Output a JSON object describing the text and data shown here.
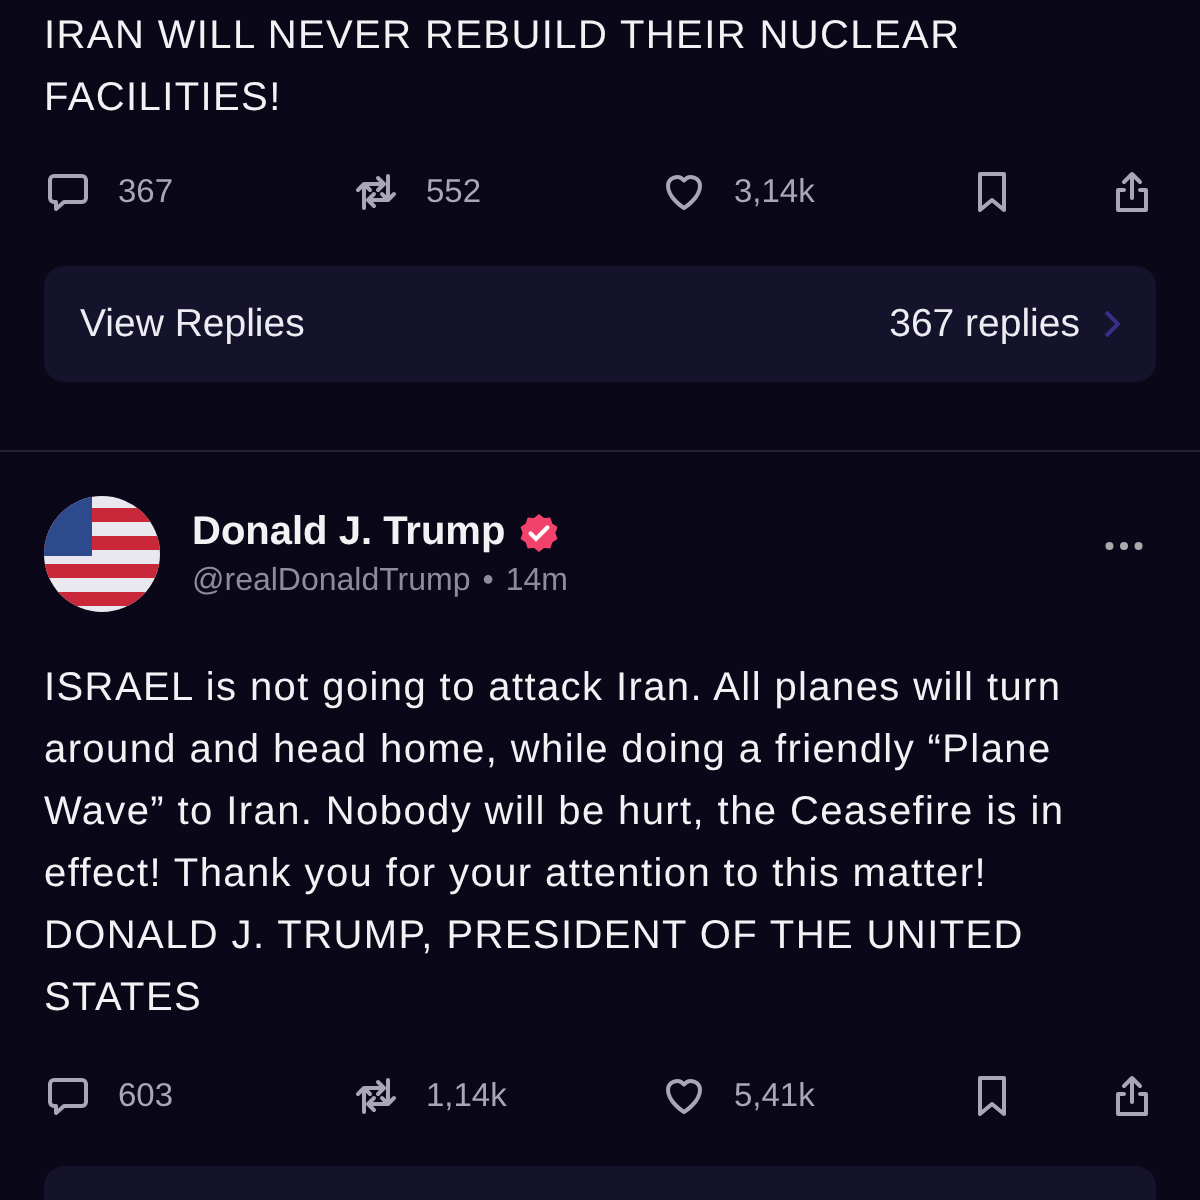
{
  "posts": [
    {
      "text": "IRAN WILL NEVER REBUILD THEIR NUCLEAR FACILITIES!",
      "replies": "367",
      "reposts": "552",
      "likes": "3,14k",
      "view_replies": {
        "label": "View Replies",
        "count": "367 replies"
      }
    },
    {
      "author": {
        "name": "Donald J. Trump",
        "verified": true,
        "handle": "@realDonaldTrump",
        "separator": "•",
        "time": "14m"
      },
      "text": "ISRAEL is not going to attack Iran. All planes will turn around and head home, while doing a friendly “Plane Wave” to Iran. Nobody will be hurt, the Ceasefire is in effect! Thank you for your attention to this matter! DONALD J. TRUMP, PRESIDENT OF THE UNITED STATES",
      "replies": "603",
      "reposts": "1,14k",
      "likes": "5,41k"
    }
  ]
}
